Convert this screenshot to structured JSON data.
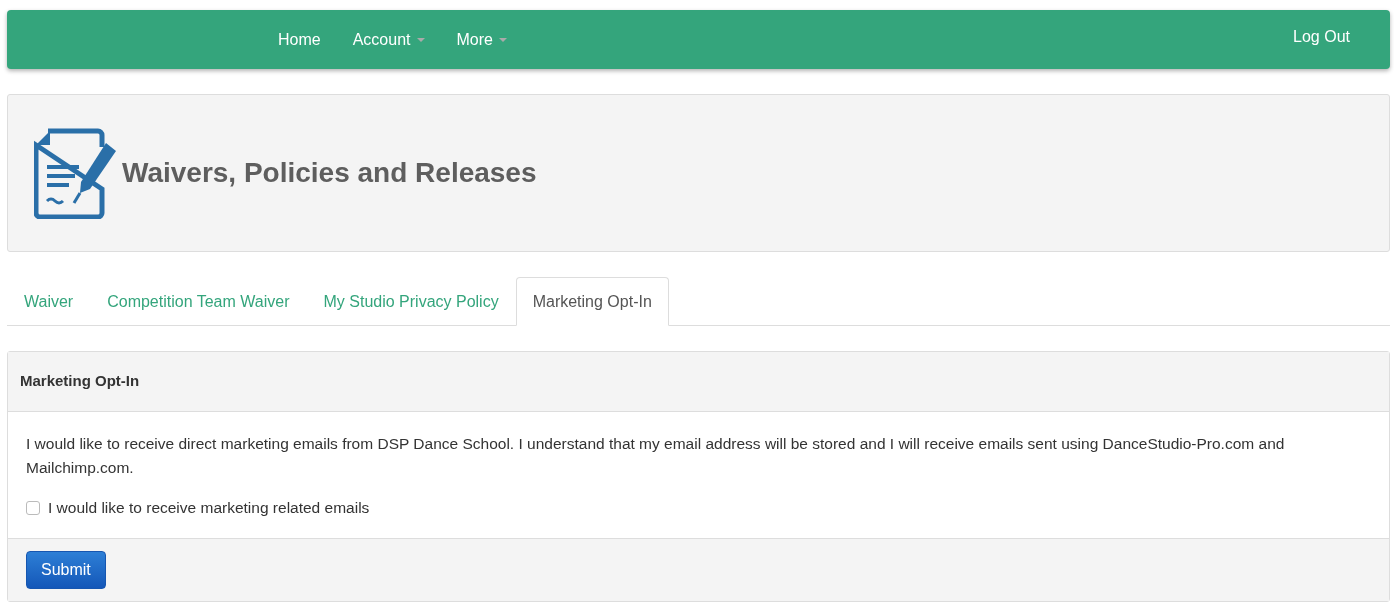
{
  "navbar": {
    "items": [
      {
        "label": "Home",
        "dropdown": false
      },
      {
        "label": "Account",
        "dropdown": true
      },
      {
        "label": "More",
        "dropdown": true
      }
    ],
    "logout": "Log Out"
  },
  "header": {
    "title": "Waivers, Policies and Releases"
  },
  "tabs": [
    {
      "label": "Waiver",
      "selected": false
    },
    {
      "label": "Competition Team Waiver",
      "selected": false
    },
    {
      "label": "My Studio Privacy Policy",
      "selected": false
    },
    {
      "label": "Marketing Opt-In",
      "selected": true
    }
  ],
  "panel": {
    "heading": "Marketing Opt-In",
    "text": "I would like to receive direct marketing emails from DSP Dance School. I understand that my email address will be stored and I will receive emails sent using DanceStudio-Pro.com and Mailchimp.com.",
    "checkbox": {
      "label": "I would like to receive marketing related emails",
      "checked": false
    },
    "button": "Submit"
  }
}
